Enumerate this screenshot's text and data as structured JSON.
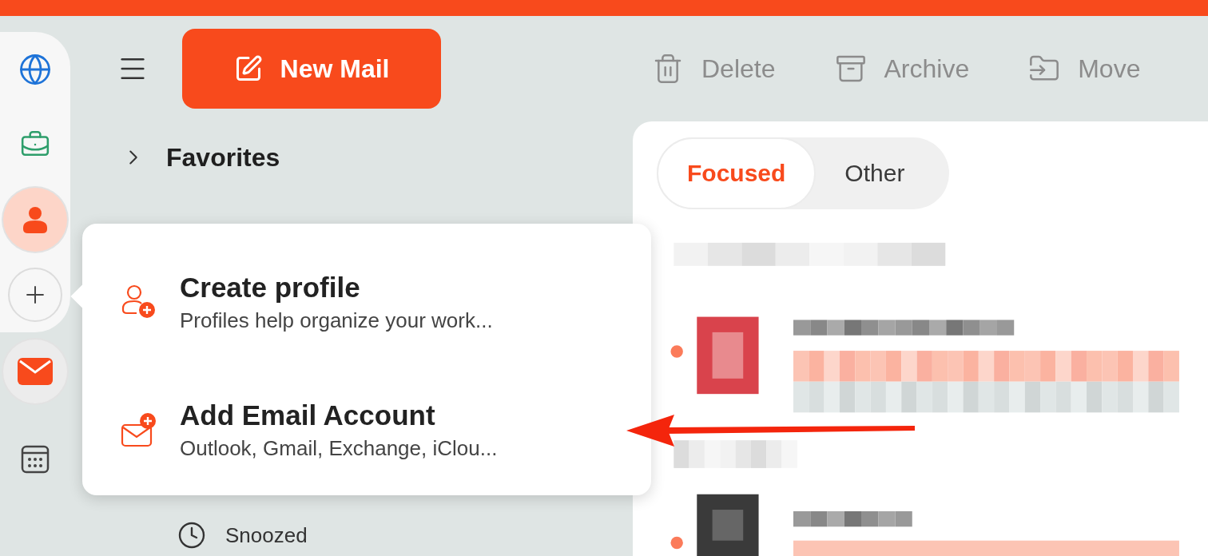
{
  "rail": {
    "items": [
      {
        "kind": "globe",
        "selected": false
      },
      {
        "kind": "briefcase",
        "selected": false
      },
      {
        "kind": "profile",
        "selected": true
      },
      {
        "kind": "add",
        "selected": false
      },
      {
        "kind": "mail",
        "selected": true
      },
      {
        "kind": "calendar",
        "selected": false
      }
    ]
  },
  "toolbar": {
    "new_mail": "New Mail",
    "actions": [
      {
        "kind": "delete",
        "label": "Delete"
      },
      {
        "kind": "archive",
        "label": "Archive"
      },
      {
        "kind": "move",
        "label": "Move"
      }
    ]
  },
  "folders": {
    "favorites": {
      "label": "Favorites",
      "expanded": false
    },
    "items": [
      {
        "kind": "snoozed",
        "label": "Snoozed"
      }
    ]
  },
  "inbox_tabs": [
    {
      "label": "Focused",
      "selected": true
    },
    {
      "label": "Other",
      "selected": false
    }
  ],
  "add_menu": {
    "items": [
      {
        "kind": "profile",
        "title": "Create profile",
        "subtitle": "Profiles help organize your work..."
      },
      {
        "kind": "email",
        "title": "Add Email Account",
        "subtitle": "Outlook, Gmail, Exchange, iClou..."
      }
    ]
  }
}
